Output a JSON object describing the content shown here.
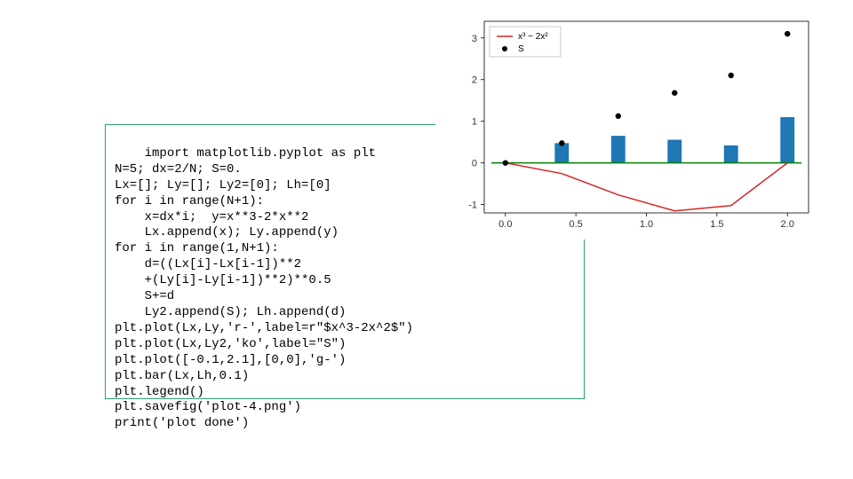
{
  "code": {
    "lines": [
      "import matplotlib.pyplot as plt",
      "N=5; dx=2/N; S=0.",
      "Lx=[]; Ly=[]; Ly2=[0]; Lh=[0]",
      "for i in range(N+1):",
      "    x=dx*i;  y=x**3-2*x**2",
      "    Lx.append(x); Ly.append(y)",
      "for i in range(1,N+1):",
      "    d=((Lx[i]-Lx[i-1])**2",
      "    +(Ly[i]-Ly[i-1])**2)**0.5",
      "    S+=d",
      "    Ly2.append(S); Lh.append(d)",
      "plt.plot(Lx,Ly,'r-',label=r\"$x^3-2x^2$\")",
      "plt.plot(Lx,Ly2,'ko',label=\"S\")",
      "plt.plot([-0.1,2.1],[0,0],'g-')",
      "plt.bar(Lx,Lh,0.1)",
      "plt.legend()",
      "plt.savefig('plot-4.png')",
      "print('plot done')"
    ]
  },
  "chart_data": {
    "type": "bar+line+scatter",
    "title": "",
    "xlabel": "",
    "ylabel": "",
    "xlim": [
      -0.15,
      2.15
    ],
    "ylim": [
      -1.2,
      3.4
    ],
    "xticks": [
      0.0,
      0.5,
      1.0,
      1.5,
      2.0
    ],
    "yticks": [
      -1,
      0,
      1,
      2,
      3
    ],
    "legend": [
      {
        "name": "x³ − 2x²",
        "marker": "red-line"
      },
      {
        "name": "S",
        "marker": "black-dot"
      }
    ],
    "series": [
      {
        "name": "x^3-2x^2 (red line)",
        "style": "red-line",
        "x": [
          0.0,
          0.4,
          0.8,
          1.2,
          1.6,
          2.0
        ],
        "y": [
          0.0,
          -0.256,
          -0.768,
          -1.152,
          -1.024,
          0.0
        ]
      },
      {
        "name": "S (black dots)",
        "style": "black-dot",
        "x": [
          0.0,
          0.4,
          0.8,
          1.2,
          1.6,
          2.0
        ],
        "y": [
          0.0,
          0.475,
          1.125,
          1.681,
          2.101,
          3.099
        ]
      },
      {
        "name": "zero line (green)",
        "style": "green-line",
        "x": [
          -0.1,
          2.1
        ],
        "y": [
          0.0,
          0.0
        ]
      },
      {
        "name": "bars (segment length)",
        "style": "blue-bar",
        "bar_width": 0.1,
        "x": [
          0.0,
          0.4,
          0.8,
          1.2,
          1.6,
          2.0
        ],
        "y": [
          0.0,
          0.475,
          0.65,
          0.556,
          0.42,
          1.099
        ]
      }
    ]
  }
}
